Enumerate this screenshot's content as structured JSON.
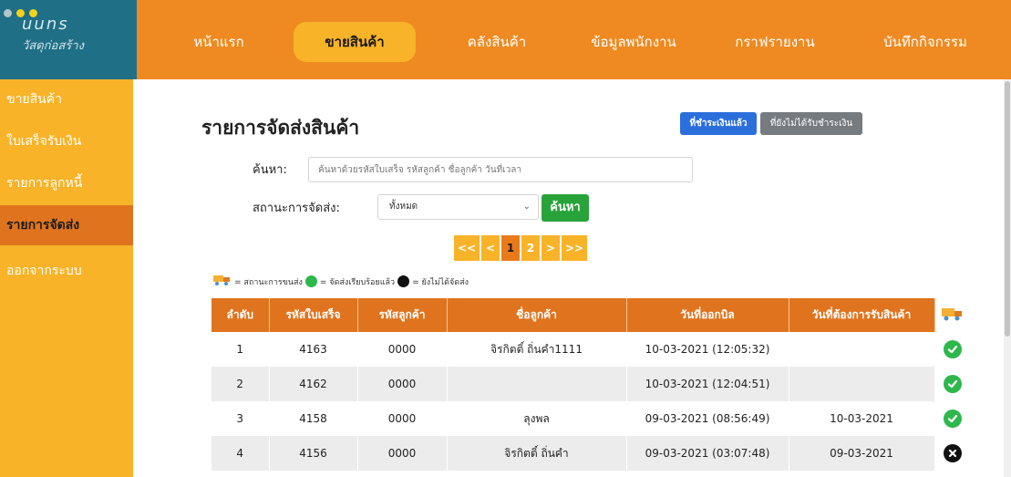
{
  "brand": {
    "title": "uuns",
    "subtitle": "วัสดุก่อสร้าง"
  },
  "window_dots": [
    "#b7c5c9",
    "#f3d21b",
    "#f3d21b"
  ],
  "nav": {
    "items": [
      {
        "label": "หน้าแรก",
        "active": false
      },
      {
        "label": "ขายสินค้า",
        "active": true
      },
      {
        "label": "คลังสินค้า",
        "active": false
      },
      {
        "label": "ข้อมูลพนักงาน",
        "active": false
      },
      {
        "label": "กราฟรายงาน",
        "active": false
      },
      {
        "label": "บันทึกกิจกรรม",
        "active": false
      }
    ]
  },
  "sidebar": {
    "items": [
      {
        "label": "ขายสินค้า",
        "active": false
      },
      {
        "label": "ใบเสร็จรับเงิน",
        "active": false
      },
      {
        "label": "รายการลูกหนี้",
        "active": false
      },
      {
        "label": "รายการจัดส่ง",
        "active": true
      },
      {
        "label": "ออกจากระบบ",
        "active": false
      }
    ]
  },
  "page": {
    "title": "รายการจัดส่งสินค้า",
    "btn_paid": "ที่ชำระเงินแล้ว",
    "btn_unpaid": "ที่ยังไม่ได้รับชำระเงิน"
  },
  "search": {
    "label": "ค้นหา:",
    "placeholder": "ค้นหาด้วยรหัสใบเสร็จ รหัสลูกค้า ชื่อลูกค้า วันที่เวลา",
    "value": ""
  },
  "status_filter": {
    "label": "สถานะการจัดส่ง:",
    "selected": "ทั้งหมด",
    "button": "ค้นหา"
  },
  "pagination": {
    "first": "<<",
    "prev": "<",
    "pages": [
      "1",
      "2"
    ],
    "current": "1",
    "next": ">",
    "last": ">>"
  },
  "legend": {
    "truck_text": "= สถานะการขนส่ง",
    "done_text": "= จัดส่งเรียบร้อยแล้ว",
    "pending_text": "= ยังไม่ได้จัดส่ง"
  },
  "table": {
    "headers": [
      "ลำดับ",
      "รหัสใบเสร็จ",
      "รหัสลูกค้า",
      "ชื่อลูกค้า",
      "วันที่ออกบิล",
      "วันที่ต้องการรับสินค้า"
    ],
    "status_header_icon": "truck-icon",
    "rows": [
      {
        "no": "1",
        "receipt": "4163",
        "customer_id": "0000",
        "name": "จิรกิตติ์ ถิ่นคำ1111",
        "bill_date": "10-03-2021 (12:05:32)",
        "want_date": "",
        "status": "done"
      },
      {
        "no": "2",
        "receipt": "4162",
        "customer_id": "0000",
        "name": "",
        "bill_date": "10-03-2021 (12:04:51)",
        "want_date": "",
        "status": "done"
      },
      {
        "no": "3",
        "receipt": "4158",
        "customer_id": "0000",
        "name": "ลุงพล",
        "bill_date": "09-03-2021 (08:56:49)",
        "want_date": "10-03-2021",
        "status": "done"
      },
      {
        "no": "4",
        "receipt": "4156",
        "customer_id": "0000",
        "name": "จิรกิตติ์ ถิ่นคำ",
        "bill_date": "09-03-2021 (03:07:48)",
        "want_date": "09-03-2021",
        "status": "pending"
      }
    ]
  },
  "colors": {
    "nav_bg": "#ee8a21",
    "sidebar_bg": "#f8b328",
    "active_orange": "#e0741e",
    "brand_bg": "#1f6f86",
    "done_green": "#2db84b",
    "pending_black": "#111111"
  }
}
